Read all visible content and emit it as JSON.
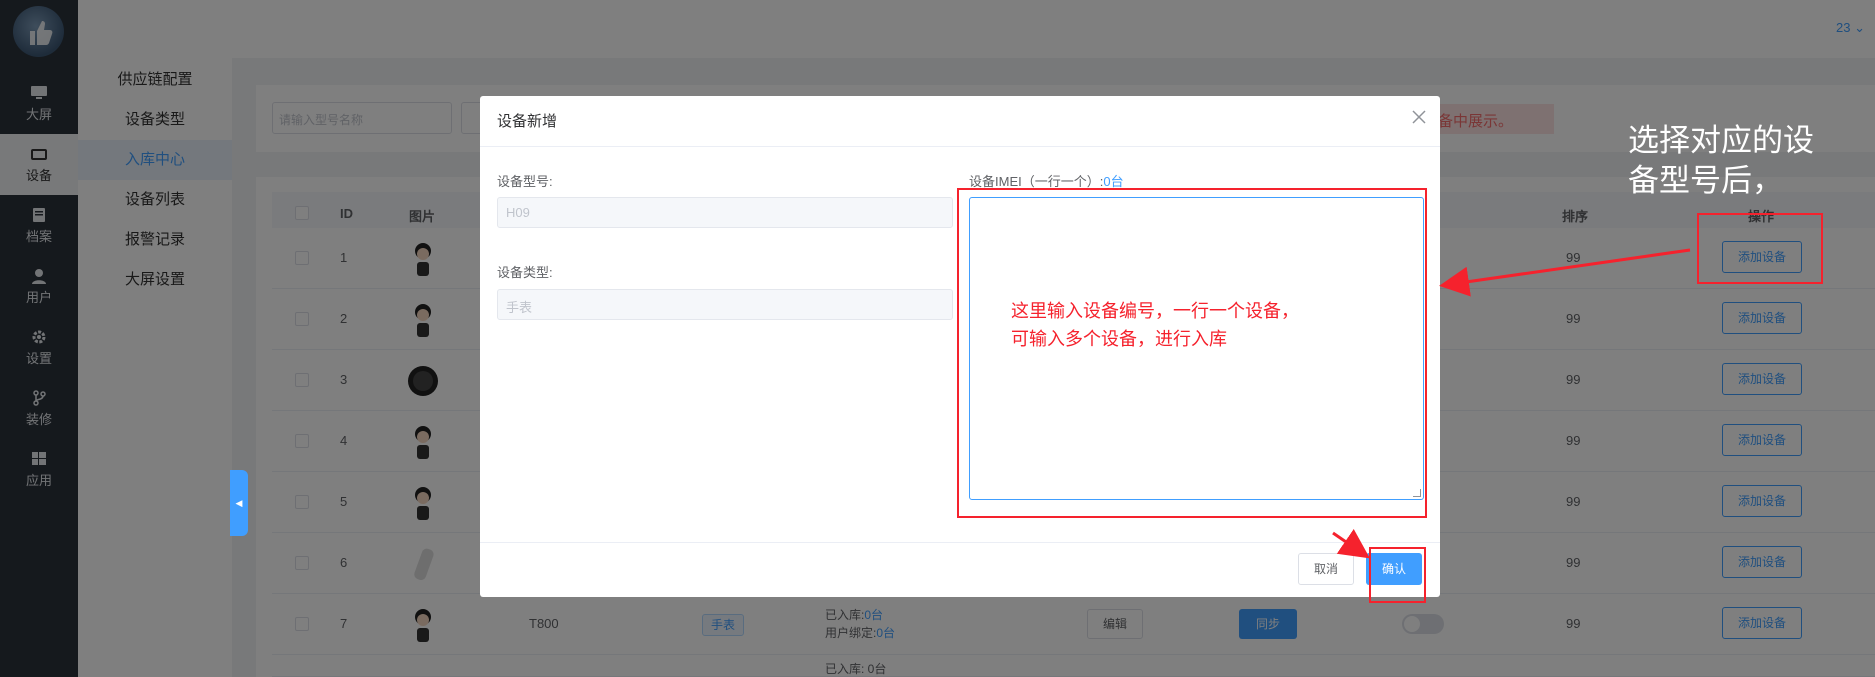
{
  "topbar": {
    "right_text": "23 ⌄"
  },
  "iconbar": {
    "items": [
      {
        "label": "大屏",
        "icon": "monitor-icon"
      },
      {
        "label": "设备",
        "icon": "device-icon"
      },
      {
        "label": "档案",
        "icon": "archive-icon"
      },
      {
        "label": "用户",
        "icon": "user-icon"
      },
      {
        "label": "设置",
        "icon": "gear-icon"
      },
      {
        "label": "装修",
        "icon": "branch-icon"
      },
      {
        "label": "应用",
        "icon": "windows-icon"
      }
    ]
  },
  "submenu": {
    "items": [
      {
        "label": "供应链配置"
      },
      {
        "label": "设备类型"
      },
      {
        "label": "入库中心"
      },
      {
        "label": "设备列表"
      },
      {
        "label": "报警记录"
      },
      {
        "label": "大屏设置"
      }
    ]
  },
  "search": {
    "placeholder": "请输入型号名称",
    "warning": "备中展示。"
  },
  "table": {
    "headers": {
      "id": "ID",
      "image": "图片",
      "sort": "排序",
      "action": "操作"
    },
    "rows": [
      {
        "id": "1",
        "sort": "99",
        "action": "添加设备"
      },
      {
        "id": "2",
        "sort": "99",
        "action": "添加设备"
      },
      {
        "id": "3",
        "sort": "99",
        "action": "添加设备"
      },
      {
        "id": "4",
        "sort": "99",
        "action": "添加设备"
      },
      {
        "id": "5",
        "sort": "99",
        "action": "添加设备"
      },
      {
        "id": "6",
        "sort": "99",
        "action": "添加设备"
      },
      {
        "id": "7",
        "sort": "99",
        "action": "添加设备",
        "model": "T800",
        "tag": "手表",
        "stocked_label": "已入库:",
        "stocked": "0台",
        "bound_label": "用户绑定:",
        "bound": "0台",
        "edit": "编辑",
        "sync": "同步"
      }
    ],
    "row8_partial": "已入库: 0台"
  },
  "dialog": {
    "title": "设备新增",
    "model_label": "设备型号:",
    "model_value": "H09",
    "type_label": "设备类型:",
    "type_value": "手表",
    "imei_label": "设备IMEI（一行一个）:",
    "imei_count": "0台",
    "cancel": "取消",
    "confirm": "确认"
  },
  "annotations": {
    "textarea_note": [
      "这里输入设备编号，一行一个设备，",
      "可输入多个设备，进行入库"
    ],
    "side_note": [
      "选择对应的设",
      "备型号后，"
    ]
  },
  "colors": {
    "accent": "#409eff",
    "annotation": "#f5222d",
    "sidebar": "#2b323b"
  }
}
